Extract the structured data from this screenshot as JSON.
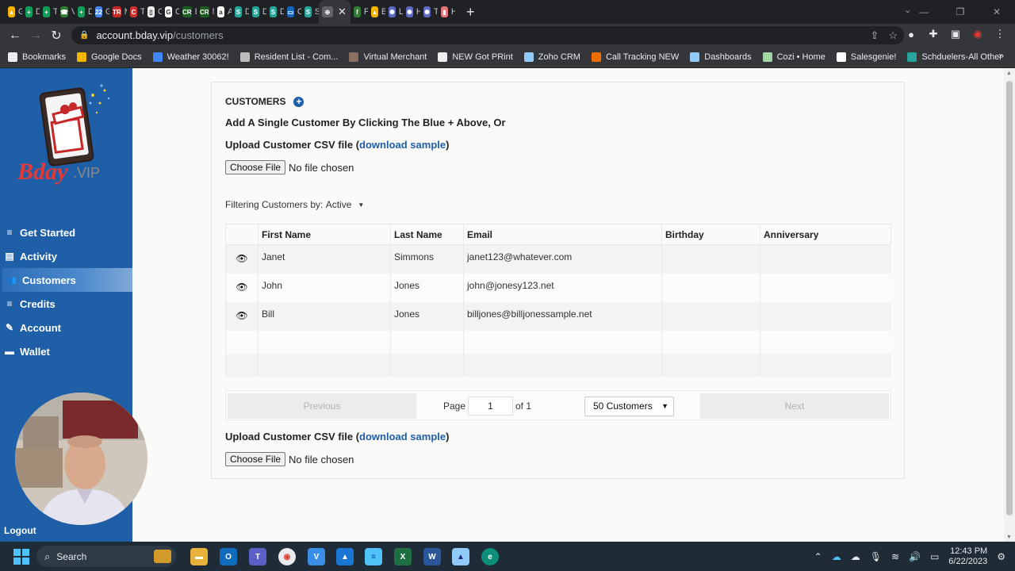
{
  "browser": {
    "tabs": [
      {
        "label": "Gi",
        "color": "#f4b400",
        "glyph": "▲"
      },
      {
        "label": "D",
        "color": "#0f9d58",
        "glyph": "+"
      },
      {
        "label": "Ti",
        "color": "#0f9d58",
        "glyph": "+"
      },
      {
        "label": "Vi",
        "color": "#2e7d32",
        "glyph": "☎"
      },
      {
        "label": "D",
        "color": "#0f9d58",
        "glyph": "+"
      },
      {
        "label": "Gi",
        "color": "#4285f4",
        "glyph": "22"
      },
      {
        "label": "M",
        "color": "#c62828",
        "glyph": "TR"
      },
      {
        "label": "Ti",
        "color": "#d32f2f",
        "glyph": "C"
      },
      {
        "label": "C",
        "color": "#eeeeee",
        "glyph": "▯"
      },
      {
        "label": "C",
        "color": "#ffffff",
        "glyph": "G"
      },
      {
        "label": "B",
        "color": "#1b5e20",
        "glyph": "CR"
      },
      {
        "label": "M",
        "color": "#1b5e20",
        "glyph": "CR"
      },
      {
        "label": "A",
        "color": "#ffffff",
        "glyph": "a"
      },
      {
        "label": "D",
        "color": "#26a69a",
        "glyph": "S"
      },
      {
        "label": "D",
        "color": "#26a69a",
        "glyph": "S"
      },
      {
        "label": "D",
        "color": "#26a69a",
        "glyph": "S"
      },
      {
        "label": "C",
        "color": "#1565c0",
        "glyph": "▭"
      },
      {
        "label": "Sl",
        "color": "#26a69a",
        "glyph": "S"
      }
    ],
    "active_tab": {
      "label": "",
      "glyph": "⊕"
    },
    "tabs_after": [
      {
        "label": "Fi",
        "color": "#2e7d32",
        "glyph": "f"
      },
      {
        "label": "B",
        "color": "#f4b400",
        "glyph": "▲"
      },
      {
        "label": "Li",
        "color": "#5c6bc0",
        "glyph": "✺"
      },
      {
        "label": "H",
        "color": "#5c6bc0",
        "glyph": "✺"
      },
      {
        "label": "Tu",
        "color": "#5c6bc0",
        "glyph": "✺"
      },
      {
        "label": "H",
        "color": "#e57373",
        "glyph": "▮"
      }
    ],
    "url_host": "account.bday.vip",
    "url_path": "/customers",
    "bookmarks": [
      {
        "label": "Bookmarks",
        "color": "#e8eaed"
      },
      {
        "label": "Google Docs",
        "color": "#f4b400"
      },
      {
        "label": "Weather 30062!",
        "color": "#4285f4"
      },
      {
        "label": "Resident List - Com...",
        "color": "#bdbdbd"
      },
      {
        "label": "Virtual Merchant",
        "color": "#8d6e63"
      },
      {
        "label": "NEW Got PRint",
        "color": "#eeeeee"
      },
      {
        "label": "Zoho CRM",
        "color": "#90caf9"
      },
      {
        "label": "Call Tracking NEW",
        "color": "#ef6c00"
      },
      {
        "label": "Dashboards",
        "color": "#90caf9"
      },
      {
        "label": "Cozi • Home",
        "color": "#a5d6a7"
      },
      {
        "label": "Salesgenie!",
        "color": "#ffffff"
      },
      {
        "label": "Schduelers-All Other",
        "color": "#26a69a"
      }
    ]
  },
  "sidebar": {
    "brand": "Bday",
    "brand_suffix": ".VIP",
    "items": [
      {
        "label": "Get Started",
        "icon": "≡"
      },
      {
        "label": "Activity",
        "icon": "▤"
      },
      {
        "label": "Customers",
        "icon": "👥"
      },
      {
        "label": "Credits",
        "icon": "≡"
      },
      {
        "label": "Account",
        "icon": "✎"
      },
      {
        "label": "Wallet",
        "icon": "▬"
      }
    ],
    "logout": "Logout"
  },
  "main": {
    "title": "CUSTOMERS",
    "add_line": "Add A Single Customer By Clicking The Blue + Above, Or",
    "upload_prefix": "Upload Customer CSV file (",
    "upload_link": "download sample",
    "upload_suffix": ")",
    "choose_file": "Choose File",
    "no_file": "No file chosen",
    "filter_label": "Filtering Customers by:",
    "filter_value": "Active",
    "columns": [
      "",
      "First Name",
      "Last Name",
      "Email",
      "Birthday",
      "Anniversary"
    ],
    "rows": [
      {
        "first": "Janet",
        "last": "Simmons",
        "email": "janet123@whatever.com",
        "birthday": "",
        "anniversary": ""
      },
      {
        "first": "John",
        "last": "Jones",
        "email": "john@jonesy123.net",
        "birthday": "",
        "anniversary": ""
      },
      {
        "first": "Bill",
        "last": "Jones",
        "email": "billjones@billjonessample.net",
        "birthday": "",
        "anniversary": ""
      }
    ],
    "pager": {
      "previous": "Previous",
      "page_label": "Page",
      "page_value": "1",
      "of_label": "of 1",
      "page_size": "50 Customers",
      "next": "Next"
    }
  },
  "taskbar": {
    "search": "Search",
    "time": "12:43 PM",
    "date": "6/22/2023"
  }
}
